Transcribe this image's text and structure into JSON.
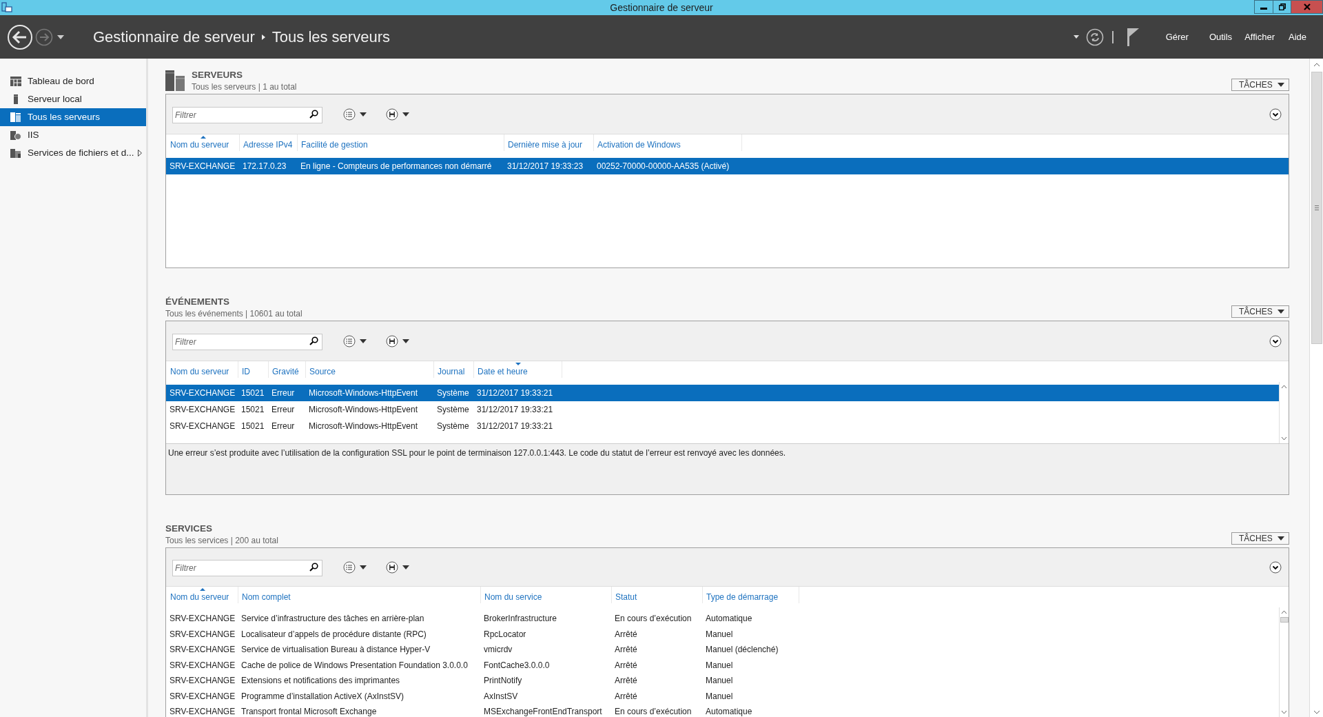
{
  "window": {
    "title": "Gestionnaire de serveur"
  },
  "header": {
    "breadcrumb": [
      "Gestionnaire de serveur",
      "Tous les serveurs"
    ],
    "menu": [
      "Gérer",
      "Outils",
      "Afficher",
      "Aide"
    ]
  },
  "sidebar": {
    "items": [
      {
        "label": "Tableau de bord",
        "selected": false,
        "expandable": false
      },
      {
        "label": "Serveur local",
        "selected": false,
        "expandable": false
      },
      {
        "label": "Tous les serveurs",
        "selected": true,
        "expandable": false
      },
      {
        "label": "IIS",
        "selected": false,
        "expandable": false
      },
      {
        "label": "Services de fichiers et d...",
        "selected": false,
        "expandable": true
      }
    ]
  },
  "sections": [
    {
      "title": "SERVEURS",
      "subtitle": "Tous les serveurs | 1 au total",
      "tasks": "TÂCHES",
      "filter": {
        "placeholder": "Filtrer"
      },
      "columns": [
        {
          "label": "Nom du serveur",
          "sorted_up": true,
          "sorted_down": false
        },
        {
          "label": "Adresse IPv4",
          "sorted_up": false,
          "sorted_down": false
        },
        {
          "label": "Facilité de gestion",
          "sorted_up": false,
          "sorted_down": false
        },
        {
          "label": "Dernière mise à jour",
          "sorted_up": false,
          "sorted_down": false
        },
        {
          "label": "Activation de Windows",
          "sorted_up": false,
          "sorted_down": false
        }
      ],
      "rows": [
        {
          "cells": [
            "SRV-EXCHANGE",
            "172.17.0.23",
            "En ligne - Compteurs de performances non démarré",
            "31/12/2017 19:33:23",
            "00252-70000-00000-AA535 (Activé)"
          ],
          "selected": true
        }
      ]
    },
    {
      "title": "ÉVÉNEMENTS",
      "subtitle": "Tous les événements | 10601 au total",
      "tasks": "TÂCHES",
      "filter": {
        "placeholder": "Filtrer"
      },
      "columns": [
        {
          "label": "Nom du serveur",
          "sorted_up": false,
          "sorted_down": false
        },
        {
          "label": "ID",
          "sorted_up": false,
          "sorted_down": false
        },
        {
          "label": "Gravité",
          "sorted_up": false,
          "sorted_down": false
        },
        {
          "label": "Source",
          "sorted_up": false,
          "sorted_down": false
        },
        {
          "label": "Journal",
          "sorted_up": false,
          "sorted_down": false
        },
        {
          "label": "Date et heure",
          "sorted_up": false,
          "sorted_down": true
        }
      ],
      "rows": [
        {
          "cells": [
            "SRV-EXCHANGE",
            "15021",
            "Erreur",
            "Microsoft-Windows-HttpEvent",
            "Système",
            "31/12/2017 19:33:21"
          ],
          "selected": true
        },
        {
          "cells": [
            "SRV-EXCHANGE",
            "15021",
            "Erreur",
            "Microsoft-Windows-HttpEvent",
            "Système",
            "31/12/2017 19:33:21"
          ],
          "selected": false
        },
        {
          "cells": [
            "SRV-EXCHANGE",
            "15021",
            "Erreur",
            "Microsoft-Windows-HttpEvent",
            "Système",
            "31/12/2017 19:33:21"
          ],
          "selected": false
        }
      ],
      "details": "Une erreur s’est produite avec l’utilisation de la configuration SSL pour le point de terminaison 127.0.0.1:443. Le code du statut de l’erreur est renvoyé avec les données."
    },
    {
      "title": "SERVICES",
      "subtitle": "Tous les services | 200 au total",
      "tasks": "TÂCHES",
      "filter": {
        "placeholder": "Filtrer"
      },
      "columns": [
        {
          "label": "Nom du serveur",
          "sorted_up": true,
          "sorted_down": false
        },
        {
          "label": "Nom complet",
          "sorted_up": false,
          "sorted_down": false
        },
        {
          "label": "Nom du service",
          "sorted_up": false,
          "sorted_down": false
        },
        {
          "label": "Statut",
          "sorted_up": false,
          "sorted_down": false
        },
        {
          "label": "Type de démarrage",
          "sorted_up": false,
          "sorted_down": false
        }
      ],
      "rows": [
        {
          "cells": [
            "SRV-EXCHANGE",
            "Service d’infrastructure des tâches en arrière-plan",
            "BrokerInfrastructure",
            "En cours d’exécution",
            "Automatique"
          ],
          "selected": false
        },
        {
          "cells": [
            "SRV-EXCHANGE",
            "Localisateur d’appels de procédure distante (RPC)",
            "RpcLocator",
            "Arrêté",
            "Manuel"
          ],
          "selected": false
        },
        {
          "cells": [
            "SRV-EXCHANGE",
            "Service de virtualisation Bureau à distance Hyper-V",
            "vmicrdv",
            "Arrêté",
            "Manuel (déclenché)"
          ],
          "selected": false
        },
        {
          "cells": [
            "SRV-EXCHANGE",
            "Cache de police de Windows Presentation Foundation 3.0.0.0",
            "FontCache3.0.0.0",
            "Arrêté",
            "Manuel"
          ],
          "selected": false
        },
        {
          "cells": [
            "SRV-EXCHANGE",
            "Extensions et notifications des imprimantes",
            "PrintNotify",
            "Arrêté",
            "Manuel"
          ],
          "selected": false
        },
        {
          "cells": [
            "SRV-EXCHANGE",
            "Programme d’installation ActiveX (AxInstSV)",
            "AxInstSV",
            "Arrêté",
            "Manuel"
          ],
          "selected": false
        },
        {
          "cells": [
            "SRV-EXCHANGE",
            "Transport frontal Microsoft Exchange",
            "MSExchangeFrontEndTransport",
            "En cours d’exécution",
            "Automatique"
          ],
          "selected": false
        }
      ]
    }
  ]
}
